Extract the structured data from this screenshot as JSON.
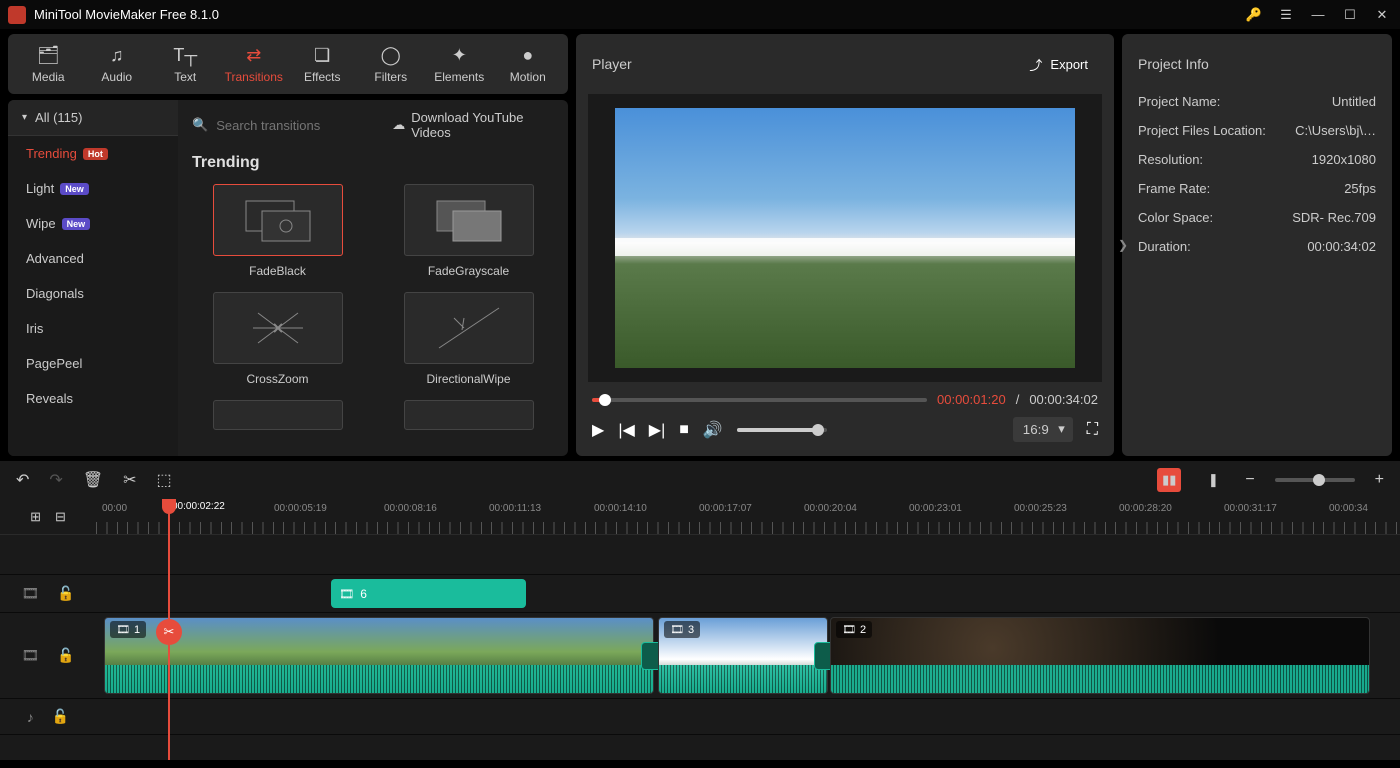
{
  "titlebar": {
    "title": "MiniTool MovieMaker Free 8.1.0"
  },
  "toolbar": {
    "items": [
      {
        "label": "Media"
      },
      {
        "label": "Audio"
      },
      {
        "label": "Text"
      },
      {
        "label": "Transitions"
      },
      {
        "label": "Effects"
      },
      {
        "label": "Filters"
      },
      {
        "label": "Elements"
      },
      {
        "label": "Motion"
      }
    ],
    "active": "Transitions"
  },
  "categories": {
    "header": "All (115)",
    "items": [
      {
        "label": "Trending",
        "badge": "Hot"
      },
      {
        "label": "Light",
        "badge": "New"
      },
      {
        "label": "Wipe",
        "badge": "New"
      },
      {
        "label": "Advanced"
      },
      {
        "label": "Diagonals"
      },
      {
        "label": "Iris"
      },
      {
        "label": "PagePeel"
      },
      {
        "label": "Reveals"
      }
    ],
    "active": "Trending"
  },
  "search": {
    "placeholder": "Search transitions"
  },
  "download_link": "Download YouTube Videos",
  "transitions": {
    "heading": "Trending",
    "items": [
      {
        "label": "FadeBlack"
      },
      {
        "label": "FadeGrayscale"
      },
      {
        "label": "CrossZoom"
      },
      {
        "label": "DirectionalWipe"
      }
    ],
    "selected": "FadeBlack"
  },
  "player": {
    "title": "Player",
    "export": "Export",
    "current_time": "00:00:01:20",
    "total_time": "00:00:34:02",
    "time_sep": " / ",
    "aspect": "16:9"
  },
  "project_info": {
    "title": "Project Info",
    "rows": [
      {
        "label": "Project Name:",
        "value": "Untitled"
      },
      {
        "label": "Project Files Location:",
        "value": "C:\\Users\\bj\\…"
      },
      {
        "label": "Resolution:",
        "value": "1920x1080"
      },
      {
        "label": "Frame Rate:",
        "value": "25fps"
      },
      {
        "label": "Color Space:",
        "value": "SDR- Rec.709"
      },
      {
        "label": "Duration:",
        "value": "00:00:34:02"
      }
    ]
  },
  "timeline": {
    "playhead_time": "00:00:02:22",
    "ruler": [
      "00:00",
      "00:00:05:19",
      "00:00:08:16",
      "00:00:11:13",
      "00:00:14:10",
      "00:00:17:07",
      "00:00:20:04",
      "00:00:23:01",
      "00:00:25:23",
      "00:00:28:20",
      "00:00:31:17",
      "00:00:34"
    ],
    "clips": {
      "green": {
        "label": "6"
      },
      "video1": {
        "label": "1"
      },
      "video3": {
        "label": "3"
      },
      "video2": {
        "label": "2"
      }
    }
  },
  "colors": {
    "accent": "#e74c3c",
    "teal": "#1abc9c"
  }
}
